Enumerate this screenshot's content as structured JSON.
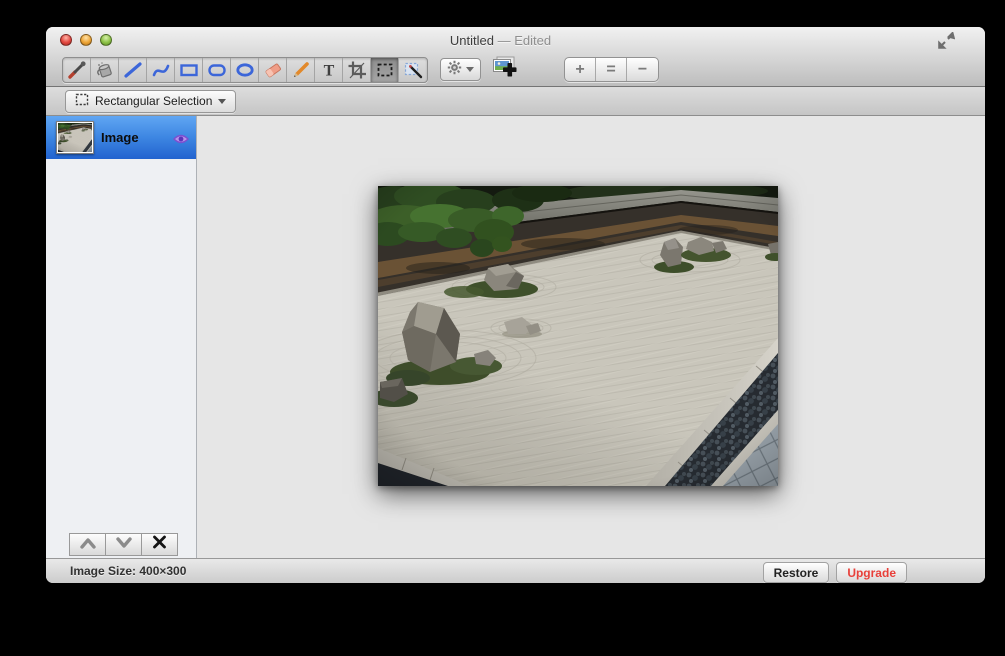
{
  "window": {
    "title": "Untitled",
    "edited_suffix": "— Edited"
  },
  "toolbar": {
    "tools": [
      {
        "id": "eyedropper",
        "selected": false
      },
      {
        "id": "paint-can",
        "selected": false
      },
      {
        "id": "line",
        "selected": false
      },
      {
        "id": "curve",
        "selected": false
      },
      {
        "id": "rectangle",
        "selected": false
      },
      {
        "id": "rounded-rectangle",
        "selected": false
      },
      {
        "id": "ellipse",
        "selected": false
      },
      {
        "id": "eraser",
        "selected": false
      },
      {
        "id": "pencil",
        "selected": false
      },
      {
        "id": "text",
        "selected": false
      },
      {
        "id": "crop",
        "selected": false
      },
      {
        "id": "rectangular-selection",
        "selected": true
      },
      {
        "id": "magic-wand",
        "selected": false
      }
    ],
    "text_tool_glyph": "T",
    "zoom": {
      "zoom_in": "+",
      "zoom_actual": "=",
      "zoom_out": "−"
    }
  },
  "options_bar": {
    "selection_mode_label": "Rectangular Selection"
  },
  "layers": {
    "items": [
      {
        "name": "Image",
        "visible": true
      }
    ]
  },
  "status_bar": {
    "image_size": "Image Size: 400×300"
  },
  "footer_buttons": {
    "restore": "Restore",
    "upgrade": "Upgrade"
  },
  "colors": {
    "selection_blue_top": "#60a6f3",
    "selection_blue_bottom": "#2263cf",
    "upgrade_red": "#e8403a",
    "tool_blue": "#3c66d9",
    "canvas_gray": "#e6e6e6"
  }
}
